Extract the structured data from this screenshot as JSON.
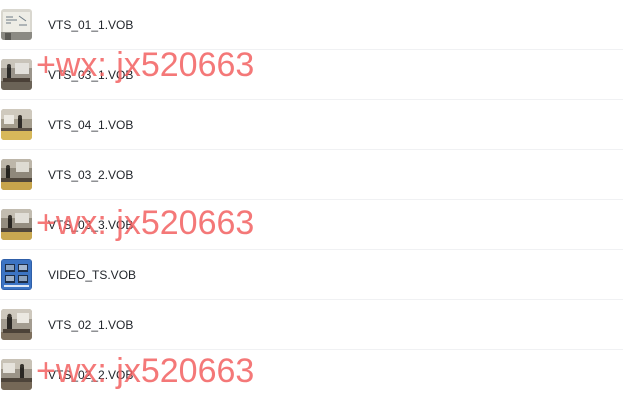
{
  "files": [
    {
      "name": "VTS_01_1.VOB",
      "thumbnail": "whiteboard-thumbnail"
    },
    {
      "name": "VTS_03_1.VOB",
      "thumbnail": "lecture-room-thumbnail"
    },
    {
      "name": "VTS_04_1.VOB",
      "thumbnail": "lecture-room-thumbnail"
    },
    {
      "name": "VTS_03_2.VOB",
      "thumbnail": "lecture-room-thumbnail"
    },
    {
      "name": "VTS_03_3.VOB",
      "thumbnail": "lecture-room-thumbnail"
    },
    {
      "name": "VIDEO_TS.VOB",
      "thumbnail": "dvd-menu-thumbnail"
    },
    {
      "name": "VTS_02_1.VOB",
      "thumbnail": "lecture-room-thumbnail"
    },
    {
      "name": "VTS_02_2.VOB",
      "thumbnail": "lecture-room-thumbnail"
    }
  ],
  "watermark": {
    "text": "+wx: jx520663",
    "color": "#f26060"
  },
  "colors": {
    "file_name_text": "#1f2329",
    "row_divider": "#f0f1f3"
  }
}
